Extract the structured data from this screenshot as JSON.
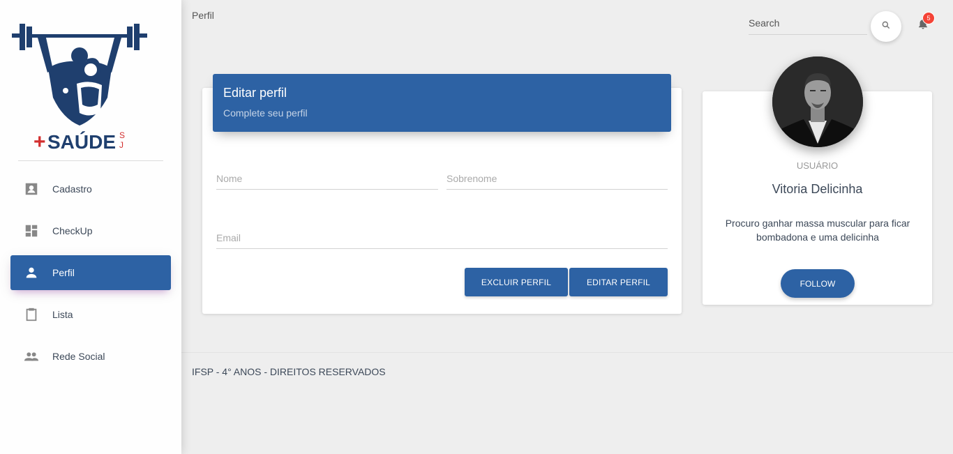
{
  "breadcrumb": "Perfil",
  "logo": {
    "text": "+SAÚDE",
    "suffix": "SJ",
    "colors": {
      "navy": "#1f3f6e",
      "red": "#d32f2f"
    }
  },
  "sidebar": {
    "items": [
      {
        "label": "Cadastro",
        "icon": "contact-card-icon",
        "active": false
      },
      {
        "label": "CheckUp",
        "icon": "dashboard-icon",
        "active": false
      },
      {
        "label": "Perfil",
        "icon": "person-icon",
        "active": true
      },
      {
        "label": "Lista",
        "icon": "clipboard-icon",
        "active": false
      },
      {
        "label": "Rede Social",
        "icon": "people-icon",
        "active": false
      }
    ]
  },
  "search": {
    "placeholder": "Search"
  },
  "notifications": {
    "count": "5"
  },
  "edit_profile": {
    "title": "Editar perfil",
    "subtitle": "Complete seu perfil",
    "fields": {
      "nome": "Nome",
      "sobrenome": "Sobrenome",
      "email": "Email"
    },
    "buttons": {
      "delete": "EXCLUIR PERFIL",
      "edit": "EDITAR PERFIL"
    }
  },
  "profile": {
    "role": "USUÁRIO",
    "name": "Vitoria Delicinha",
    "description": "Procuro ganhar massa muscular para ficar bombadona e uma delicinha",
    "follow": "FOLLOW"
  },
  "footer": "IFSP - 4° ANOS - DIREITOS RESERVADOS",
  "colors": {
    "primary": "#2d62a4",
    "badge": "#f44336",
    "background": "#eeeeee"
  }
}
